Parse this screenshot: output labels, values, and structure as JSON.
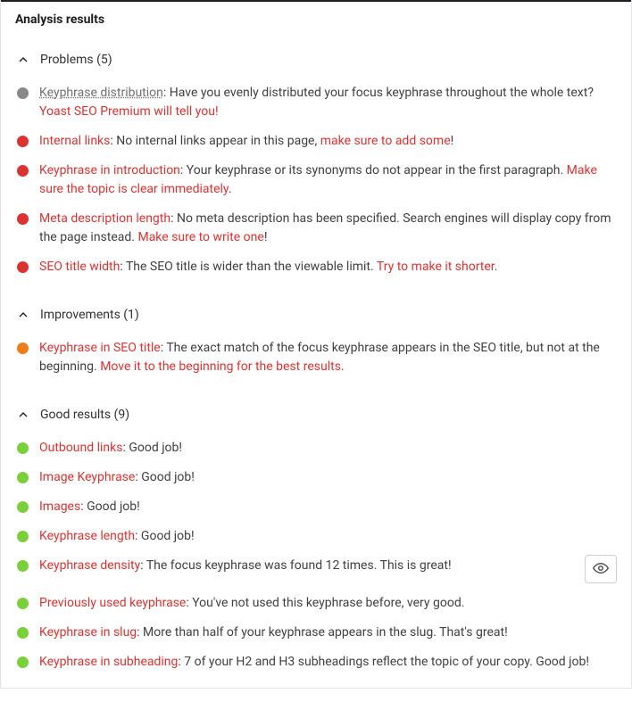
{
  "title": "Analysis results",
  "colors": {
    "red": "#dc3232",
    "orange": "#ee7c1b",
    "green": "#7ad03a",
    "gray": "#888888"
  },
  "sections": [
    {
      "id": "problems",
      "label": "Problems (5)",
      "expanded": true,
      "items": [
        {
          "bullet": "gray",
          "hasEye": false,
          "parts": [
            {
              "t": "link",
              "style": "gray",
              "text": "Keyphrase distribution"
            },
            {
              "t": "text",
              "text": ": Have you evenly distributed your focus keyphrase throughout the whole text? "
            },
            {
              "t": "link",
              "style": "red",
              "text": "Yoast SEO Premium will tell you!"
            }
          ]
        },
        {
          "bullet": "red",
          "hasEye": false,
          "parts": [
            {
              "t": "link",
              "style": "red",
              "text": "Internal links"
            },
            {
              "t": "text",
              "text": ": No internal links appear in this page, "
            },
            {
              "t": "link",
              "style": "red",
              "text": "make sure to add some"
            },
            {
              "t": "text",
              "text": "!"
            }
          ]
        },
        {
          "bullet": "red",
          "hasEye": false,
          "parts": [
            {
              "t": "link",
              "style": "red",
              "text": "Keyphrase in introduction"
            },
            {
              "t": "text",
              "text": ": Your keyphrase or its synonyms do not appear in the first paragraph. "
            },
            {
              "t": "link",
              "style": "red",
              "text": "Make sure the topic is clear immediately"
            },
            {
              "t": "text",
              "text": "."
            }
          ]
        },
        {
          "bullet": "red",
          "hasEye": false,
          "parts": [
            {
              "t": "link",
              "style": "red",
              "text": "Meta description length"
            },
            {
              "t": "text",
              "text": ": No meta description has been specified. Search engines will display copy from the page instead. "
            },
            {
              "t": "link",
              "style": "red",
              "text": "Make sure to write one"
            },
            {
              "t": "text",
              "text": "!"
            }
          ]
        },
        {
          "bullet": "red",
          "hasEye": false,
          "parts": [
            {
              "t": "link",
              "style": "red",
              "text": "SEO title width"
            },
            {
              "t": "text",
              "text": ": The SEO title is wider than the viewable limit. "
            },
            {
              "t": "link",
              "style": "red",
              "text": "Try to make it shorter"
            },
            {
              "t": "text",
              "text": "."
            }
          ]
        }
      ]
    },
    {
      "id": "improvements",
      "label": "Improvements (1)",
      "expanded": true,
      "items": [
        {
          "bullet": "orange",
          "hasEye": false,
          "parts": [
            {
              "t": "link",
              "style": "red",
              "text": "Keyphrase in SEO title"
            },
            {
              "t": "text",
              "text": ": The exact match of the focus keyphrase appears in the SEO title, but not at the beginning. "
            },
            {
              "t": "link",
              "style": "red",
              "text": "Move it to the beginning for the best results"
            },
            {
              "t": "text",
              "text": "."
            }
          ]
        }
      ]
    },
    {
      "id": "good",
      "label": "Good results (9)",
      "expanded": true,
      "items": [
        {
          "bullet": "green",
          "hasEye": false,
          "parts": [
            {
              "t": "link",
              "style": "red",
              "text": "Outbound links"
            },
            {
              "t": "text",
              "text": ": Good job!"
            }
          ]
        },
        {
          "bullet": "green",
          "hasEye": false,
          "parts": [
            {
              "t": "link",
              "style": "red",
              "text": "Image Keyphrase"
            },
            {
              "t": "text",
              "text": ": Good job!"
            }
          ]
        },
        {
          "bullet": "green",
          "hasEye": false,
          "parts": [
            {
              "t": "link",
              "style": "red",
              "text": "Images"
            },
            {
              "t": "text",
              "text": ": Good job!"
            }
          ]
        },
        {
          "bullet": "green",
          "hasEye": false,
          "parts": [
            {
              "t": "link",
              "style": "red",
              "text": "Keyphrase length"
            },
            {
              "t": "text",
              "text": ": Good job!"
            }
          ]
        },
        {
          "bullet": "green",
          "hasEye": true,
          "parts": [
            {
              "t": "link",
              "style": "red",
              "text": "Keyphrase density"
            },
            {
              "t": "text",
              "text": ": The focus keyphrase was found 12 times. This is great!"
            }
          ]
        },
        {
          "bullet": "green",
          "hasEye": false,
          "parts": [
            {
              "t": "link",
              "style": "red",
              "text": "Previously used keyphrase"
            },
            {
              "t": "text",
              "text": ": You've not used this keyphrase before, very good."
            }
          ]
        },
        {
          "bullet": "green",
          "hasEye": false,
          "parts": [
            {
              "t": "link",
              "style": "red",
              "text": "Keyphrase in slug"
            },
            {
              "t": "text",
              "text": ": More than half of your keyphrase appears in the slug. That's great!"
            }
          ]
        },
        {
          "bullet": "green",
          "hasEye": false,
          "parts": [
            {
              "t": "link",
              "style": "red",
              "text": "Keyphrase in subheading"
            },
            {
              "t": "text",
              "text": ": 7 of your H2 and H3 subheadings reflect the topic of your copy. Good job!"
            }
          ]
        }
      ]
    }
  ]
}
